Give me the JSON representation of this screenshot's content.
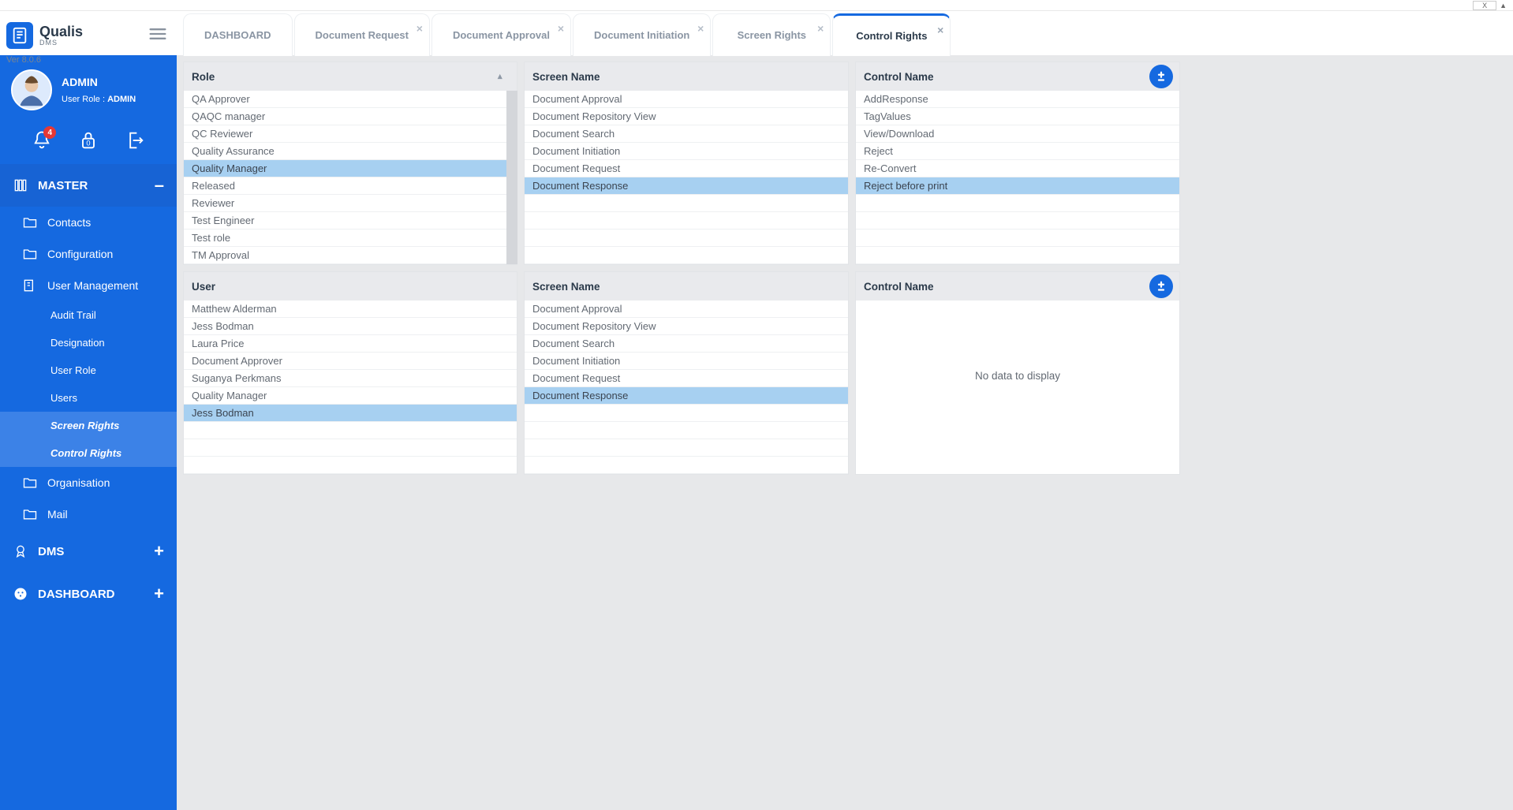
{
  "version": "Ver 8.0.6",
  "brand": {
    "name": "Qualis",
    "sub": "DMS"
  },
  "user": {
    "name": "ADMIN",
    "role_prefix": "User Role :",
    "role": "ADMIN"
  },
  "notif_count": "4",
  "lock_count": "0",
  "tabs": [
    {
      "label": "DASHBOARD",
      "closable": false,
      "active": false
    },
    {
      "label": "Document Request",
      "closable": true,
      "active": false
    },
    {
      "label": "Document Approval",
      "closable": true,
      "active": false
    },
    {
      "label": "Document Initiation",
      "closable": true,
      "active": false
    },
    {
      "label": "Screen Rights",
      "closable": true,
      "active": false
    },
    {
      "label": "Control Rights",
      "closable": true,
      "active": true
    }
  ],
  "win": {
    "close": "X",
    "tri": "▲"
  },
  "sidebar": {
    "sections": [
      {
        "label": "MASTER",
        "open": true,
        "icon": "server",
        "toggle": "–"
      },
      {
        "label": "DMS",
        "open": false,
        "icon": "ribbon",
        "toggle": "+"
      },
      {
        "label": "DASHBOARD",
        "open": false,
        "icon": "dash",
        "toggle": "+"
      }
    ],
    "master_items": [
      {
        "label": "Contacts",
        "icon": "folder"
      },
      {
        "label": "Configuration",
        "icon": "folder"
      },
      {
        "label": "User Management",
        "icon": "usermgmt",
        "children": [
          "Audit Trail",
          "Designation",
          "User Role",
          "Users",
          "Screen Rights",
          "Control Rights"
        ],
        "hl": [
          4,
          5
        ]
      },
      {
        "label": "Organisation",
        "icon": "folder"
      },
      {
        "label": "Mail",
        "icon": "folder"
      }
    ]
  },
  "panel_headers": {
    "role": "Role",
    "screen": "Screen Name",
    "control": "Control Name",
    "user": "User"
  },
  "roles": [
    "QA Approver",
    "QAQC manager",
    "QC Reviewer",
    "Quality Assurance",
    "Quality Manager",
    "Released",
    "Reviewer",
    "Test Engineer",
    "Test role",
    "TM Approval"
  ],
  "role_selected": 4,
  "screens1": [
    "Document Approval",
    "Document Repository View",
    "Document Search",
    "Document Initiation",
    "Document Request",
    "Document Response"
  ],
  "screens1_sel": 5,
  "controls1": [
    "AddResponse",
    "TagValues",
    "View/Download",
    "Reject",
    "Re-Convert",
    "Reject before print"
  ],
  "controls1_sel": 5,
  "users": [
    "Matthew Alderman",
    "Jess Bodman",
    "Laura Price",
    "Document Approver",
    "Suganya Perkmans",
    "Quality Manager",
    "Jess Bodman"
  ],
  "users_sel": 6,
  "screens2": [
    "Document Approval",
    "Document Repository View",
    "Document Search",
    "Document Initiation",
    "Document Request",
    "Document Response"
  ],
  "screens2_sel": 5,
  "nodata": "No data to display"
}
